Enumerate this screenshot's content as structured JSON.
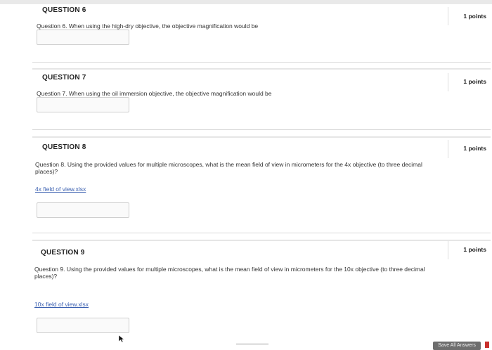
{
  "questions": [
    {
      "heading": "QUESTION 6",
      "points": "1 points",
      "text": "Question 6. When using the high-dry objective, the objective magnification would be",
      "link": ""
    },
    {
      "heading": "QUESTION 7",
      "points": "1 points",
      "text": "Question 7. When using the oil immersion objective, the objective magnification would be",
      "link": ""
    },
    {
      "heading": "QUESTION 8",
      "points": "1 points",
      "text": "Question 8. Using the provided values for multiple microscopes, what is the mean field of view in micrometers for the 4x objective (to three decimal places)?",
      "link": "4x field of view.xlsx"
    },
    {
      "heading": "QUESTION 9",
      "points": "1 points",
      "text": "Question 9. Using the provided values for multiple microscopes, what is the mean field of view in micrometers for the 10x objective (to three decimal places)?",
      "link": "10x field of view.xlsx"
    }
  ],
  "footer": {
    "save_label": "Save All Answers"
  }
}
